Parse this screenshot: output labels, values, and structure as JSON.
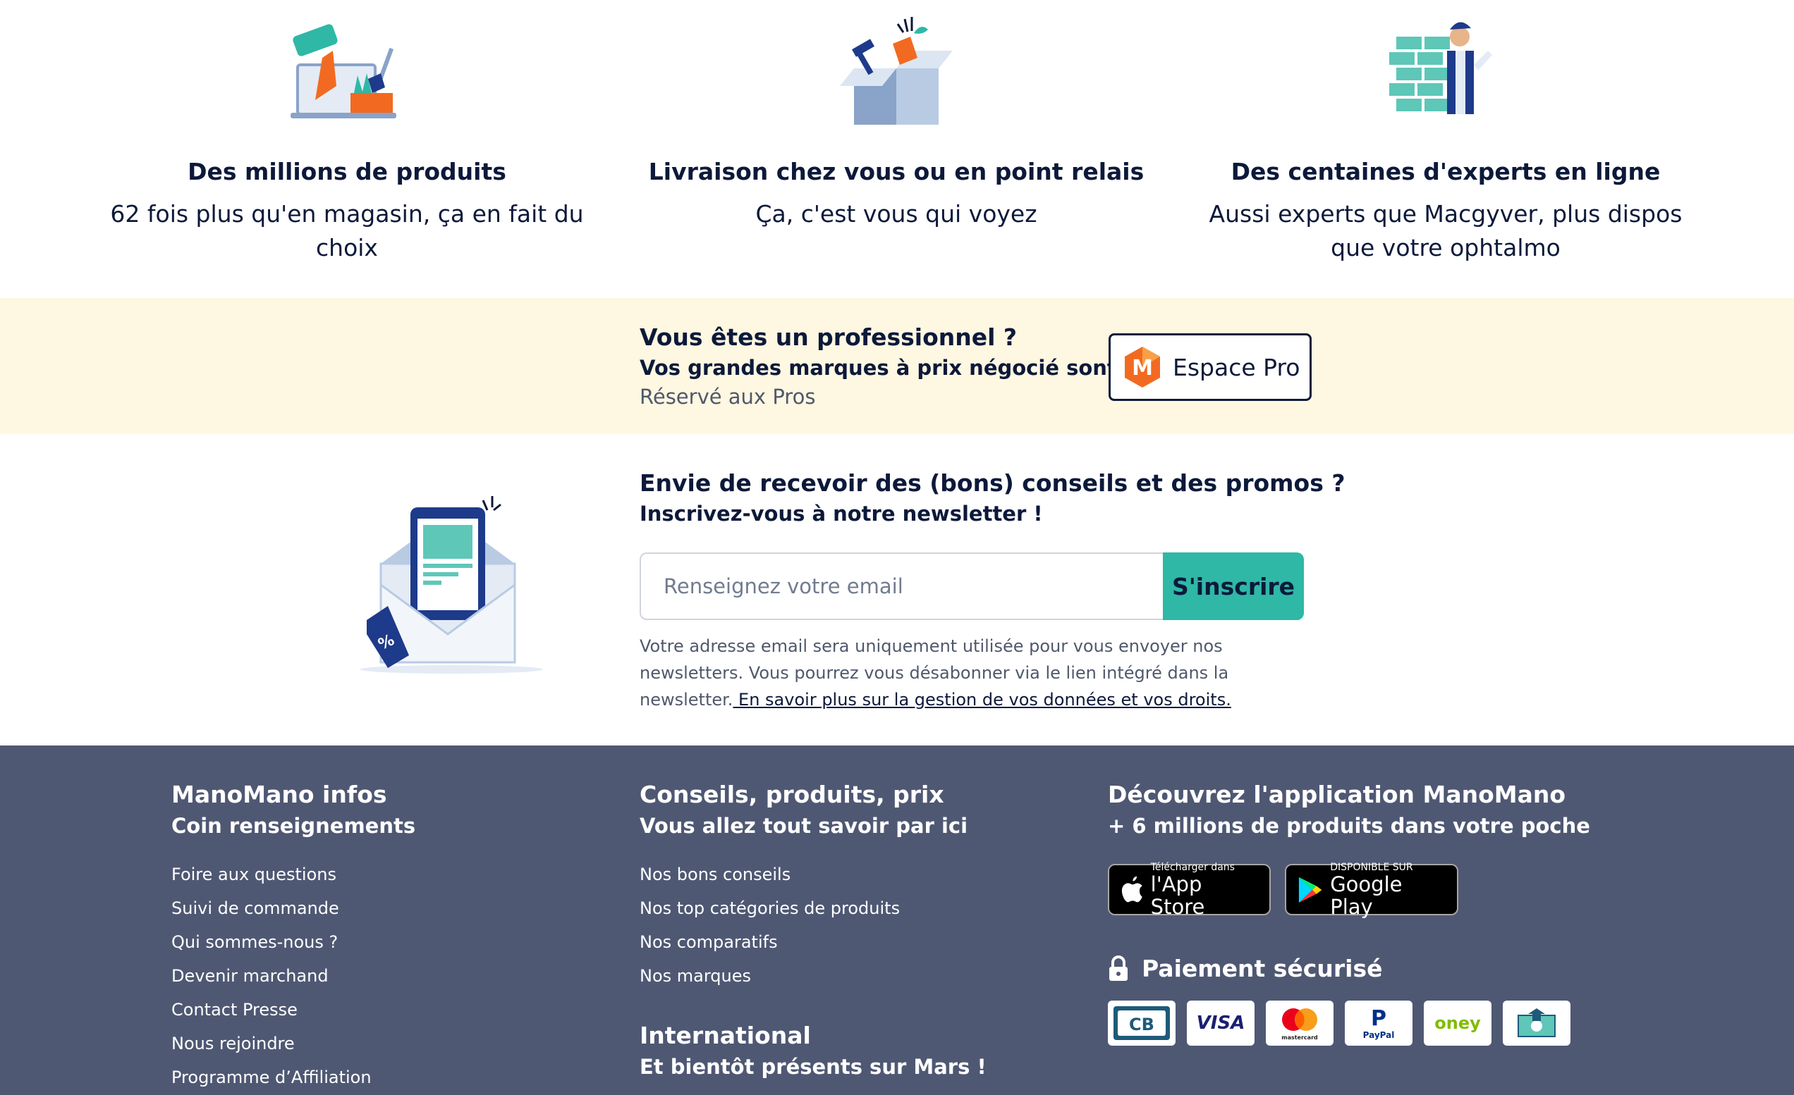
{
  "features": [
    {
      "title": "Des millions de produits",
      "desc": "62 fois plus qu'en magasin, ça en fait du choix",
      "icon": "paint-roller-laptop-illustration"
    },
    {
      "title": "Livraison chez vous ou en point relais",
      "desc": "Ça, c'est vous qui voyez",
      "icon": "delivery-box-illustration"
    },
    {
      "title": "Des centaines d'experts en ligne",
      "desc": "Aussi experts que Macgyver, plus dispos que votre ophtalmo",
      "icon": "expert-bricklayer-illustration"
    }
  ],
  "pro": {
    "title": "Vous êtes un professionnel ?",
    "subtitle": "Vos grandes marques à prix négocié sont ici.",
    "note": "Réservé aux Pros",
    "button_label": "Espace Pro",
    "button_icon": "manomano-logo-icon",
    "background": "#fef7e1"
  },
  "newsletter": {
    "title": "Envie de recevoir des (bons) conseils et des promos ?",
    "subtitle": "Inscrivez-vous à notre newsletter !",
    "email_placeholder": "Renseignez votre email",
    "email_value": "",
    "submit_label": "S'inscrire",
    "legal_text": "Votre adresse email sera uniquement utilisée pour vous envoyer nos newsletters. Vous pourrez vous désabonner via le lien intégré dans la newsletter.",
    "legal_link": " En savoir plus sur la gestion de vos données et vos droits.",
    "accent": "#2eb8a5"
  },
  "footer": {
    "background": "#4f5873",
    "infos": {
      "title": "ManoMano infos",
      "subtitle": "Coin renseignements",
      "links": [
        "Foire aux questions",
        "Suivi de commande",
        "Qui sommes-nous ?",
        "Devenir marchand",
        "Contact Presse",
        "Nous rejoindre",
        "Programme d’Affiliation"
      ]
    },
    "conseils": {
      "title": "Conseils, produits, prix",
      "subtitle": "Vous allez tout savoir par ici",
      "links": [
        "Nos bons conseils",
        "Nos top catégories de produits",
        "Nos comparatifs",
        "Nos marques"
      ]
    },
    "international": {
      "title": "International",
      "subtitle": "Et bientôt présents sur Mars !"
    },
    "app": {
      "title": "Découvrez l'application ManoMano",
      "subtitle": "+ 6 millions de produits dans votre poche",
      "appstore_small": "Télécharger dans",
      "appstore_big": "l'App Store",
      "googleplay_small": "DISPONIBLE SUR",
      "googleplay_big": "Google Play"
    },
    "payment": {
      "title": "Paiement sécurisé",
      "cards": [
        "CB",
        "VISA",
        "mastercard",
        "PayPal",
        "oney",
        "virement"
      ]
    }
  }
}
